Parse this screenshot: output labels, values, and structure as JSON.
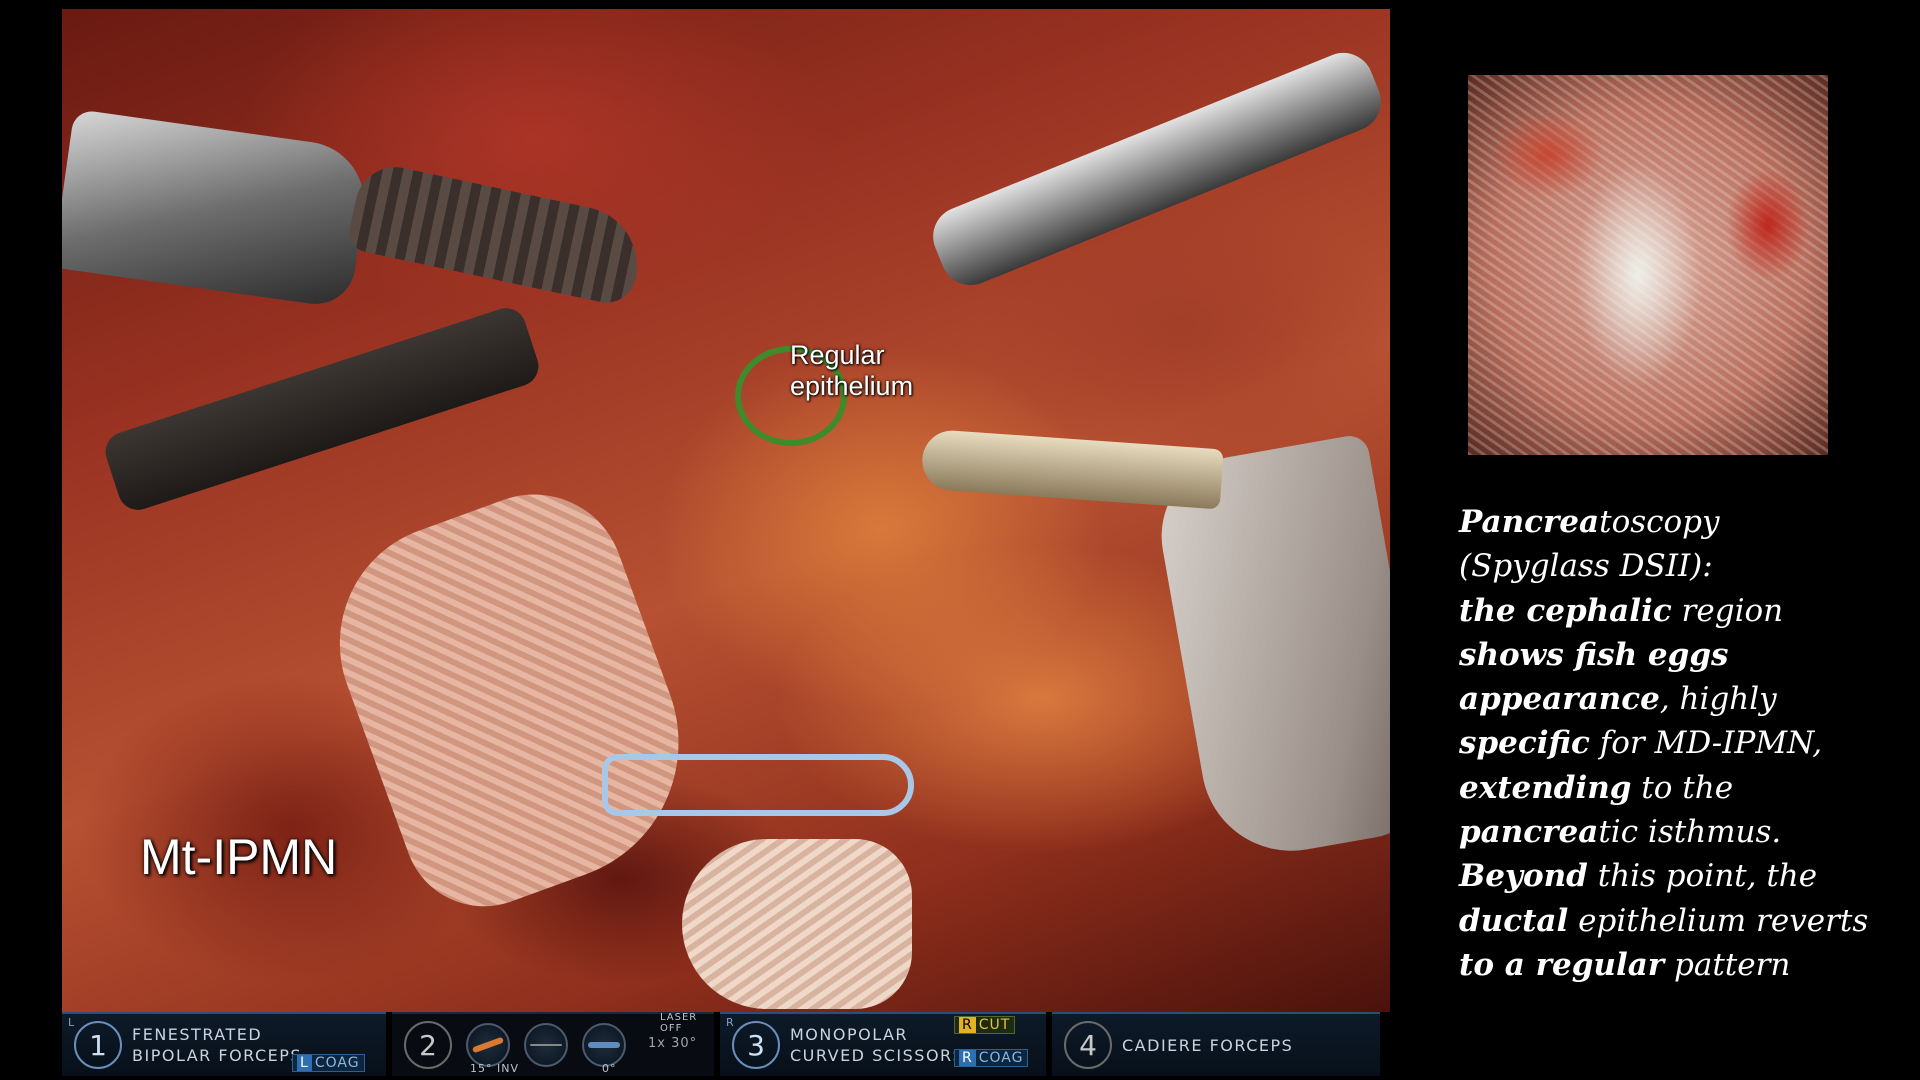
{
  "annotations": {
    "regular_line1": "Regular",
    "regular_line2": "epithelium",
    "lesion_label": "Mt-IPMN"
  },
  "instruments": {
    "arm1": {
      "index": "L",
      "number": "1",
      "line1": "FENESTRATED",
      "line2": "BIPOLAR FORCEPS",
      "energy_mode": "L",
      "energy_label": "COAG"
    },
    "arm2": {
      "number": "2",
      "tilt": "15° INV",
      "level": "0°",
      "laser": "LASER OFF",
      "zoom": "1x  30°"
    },
    "arm3": {
      "index": "R",
      "number": "3",
      "line1": "MONOPOLAR",
      "line2": "CURVED SCISSORS",
      "cut_mode": "R",
      "cut_label": "CUT",
      "coag_mode": "R",
      "coag_label": "COAG"
    },
    "arm4": {
      "number": "4",
      "name": "CADIERE FORCEPS"
    }
  },
  "caption": {
    "l1_a": "Pancrea",
    "l1_b": "toscopy",
    "l2": "(Spyglass DSII):",
    "l3_a": "the cephalic",
    "l3_b": " region",
    "l4_a": "shows  fish eggs",
    "l5_a": "appearance",
    "l5_b": ", highly",
    "l6_a": "specific",
    "l6_b": " for MD-IPMN,",
    "l7_a": "extending",
    "l7_b": "  to the",
    "l8_a": "pancrea",
    "l8_b": "tic isthmus.",
    "l9_a": "Beyond",
    "l9_b": " this point, the",
    "l10_a": "ductal",
    "l10_b": " epithelium reverts",
    "l11_a": "to a regular",
    "l11_b": " pattern"
  },
  "colors": {
    "circle": "#3f8a2a",
    "panel_border": "#2d4f73",
    "cut_accent": "#e0b224",
    "coag_accent": "#2d6fb0"
  }
}
